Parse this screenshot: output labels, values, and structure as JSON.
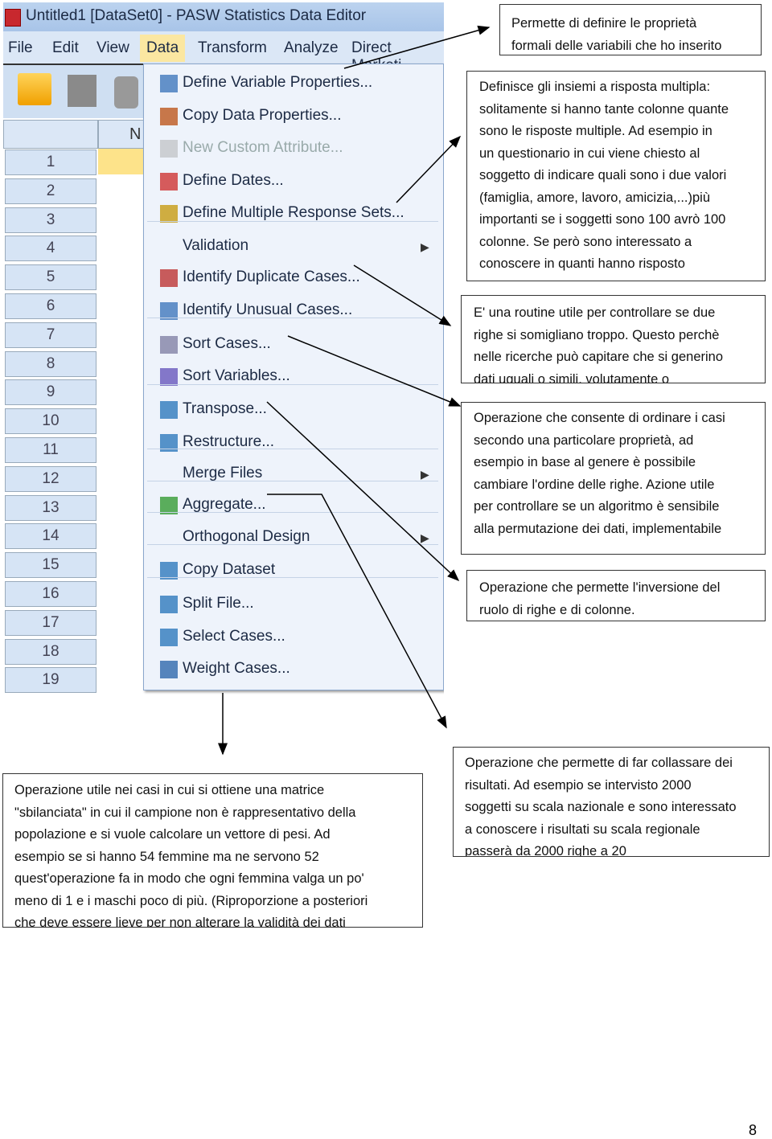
{
  "window": {
    "title": "Untitled1 [DataSet0] - PASW Statistics Data Editor"
  },
  "menubar": [
    "File",
    "Edit",
    "View",
    "Data",
    "Transform",
    "Analyze",
    "Direct Marketi"
  ],
  "grid": {
    "column_header": "N",
    "rows": [
      "1",
      "2",
      "3",
      "4",
      "5",
      "6",
      "7",
      "8",
      "9",
      "10",
      "11",
      "12",
      "13",
      "14",
      "15",
      "16",
      "17",
      "18",
      "19"
    ]
  },
  "menu": {
    "items": [
      {
        "label": "Define Variable Properties...",
        "icon": "define-variable-icon"
      },
      {
        "label": "Copy Data Properties...",
        "icon": "copy-data-icon"
      },
      {
        "label": "New Custom Attribute...",
        "icon": "custom-attribute-icon",
        "disabled": true
      },
      {
        "label": "Define Dates...",
        "icon": "calendar-icon"
      },
      {
        "label": "Define Multiple Response Sets...",
        "icon": "grid-icon"
      },
      {
        "label": "Validation",
        "submenu": true
      },
      {
        "label": "Identify Duplicate Cases...",
        "icon": "duplicate-icon"
      },
      {
        "label": "Identify Unusual Cases...",
        "icon": "unusual-icon"
      },
      {
        "label": "Sort Cases...",
        "icon": "sort-cases-icon"
      },
      {
        "label": "Sort Variables...",
        "icon": "sort-variables-icon"
      },
      {
        "label": "Transpose...",
        "icon": "transpose-icon"
      },
      {
        "label": "Restructure...",
        "icon": "restructure-icon"
      },
      {
        "label": "Merge Files",
        "submenu": true
      },
      {
        "label": "Aggregate...",
        "icon": "aggregate-icon"
      },
      {
        "label": "Orthogonal Design",
        "submenu": true
      },
      {
        "label": "Copy Dataset",
        "icon": "copy-dataset-icon"
      },
      {
        "label": "Split File...",
        "icon": "split-icon"
      },
      {
        "label": "Select Cases...",
        "icon": "select-icon"
      },
      {
        "label": "Weight Cases...",
        "icon": "scale-icon"
      }
    ]
  },
  "notes": {
    "variable_properties": [
      "Permette di definire le proprietà",
      "formali delle variabili che ho inserito"
    ],
    "multiple_response": [
      "Definisce gli insiemi a risposta multipla:",
      "solitamente si hanno tante colonne quante",
      "sono le risposte multiple. Ad esempio in",
      "un questionario in cui viene chiesto al",
      "soggetto di indicare quali sono i due valori",
      "(famiglia, amore, lavoro, amicizia,...)più",
      "importanti se i soggetti sono 100 avrò 100",
      "colonne. Se però sono interessato a",
      "conoscere in quanti hanno risposto"
    ],
    "duplicate": [
      "E' una routine utile per controllare se due",
      "righe si somigliano troppo. Questo perchè",
      "nelle ricerche può capitare che si generino",
      "dati uguali o simili, volutamente o"
    ],
    "sort": [
      "Operazione che consente di ordinare i casi",
      "secondo una particolare proprietà, ad",
      "esempio in base al genere è possibile",
      "cambiare l'ordine delle righe. Azione utile",
      "per controllare se un algoritmo è sensibile",
      "alla permutazione dei dati, implementabile"
    ],
    "transpose": [
      "Operazione che permette l'inversione del",
      "ruolo di righe e di colonne."
    ],
    "weight": [
      "Operazione utile nei casi in cui si ottiene una matrice",
      "\"sbilanciata\" in cui il campione non è rappresentativo della",
      "popolazione e si vuole calcolare un vettore di pesi. Ad",
      "esempio se si hanno 54 femmine ma ne servono 52",
      "quest'operazione fa in modo che ogni femmina valga un po'",
      "meno di 1 e i maschi poco di più. (Riproporzione a posteriori",
      "che deve essere lieve per non alterare la validità dei dati"
    ],
    "aggregate": [
      "Operazione che permette di far collassare dei",
      "risultati. Ad esempio se intervisto 2000",
      "soggetti su scala nazionale e sono interessato",
      "a conoscere i risultati su scala regionale",
      "passerà da 2000 righe a 20"
    ]
  },
  "page_number": "8"
}
